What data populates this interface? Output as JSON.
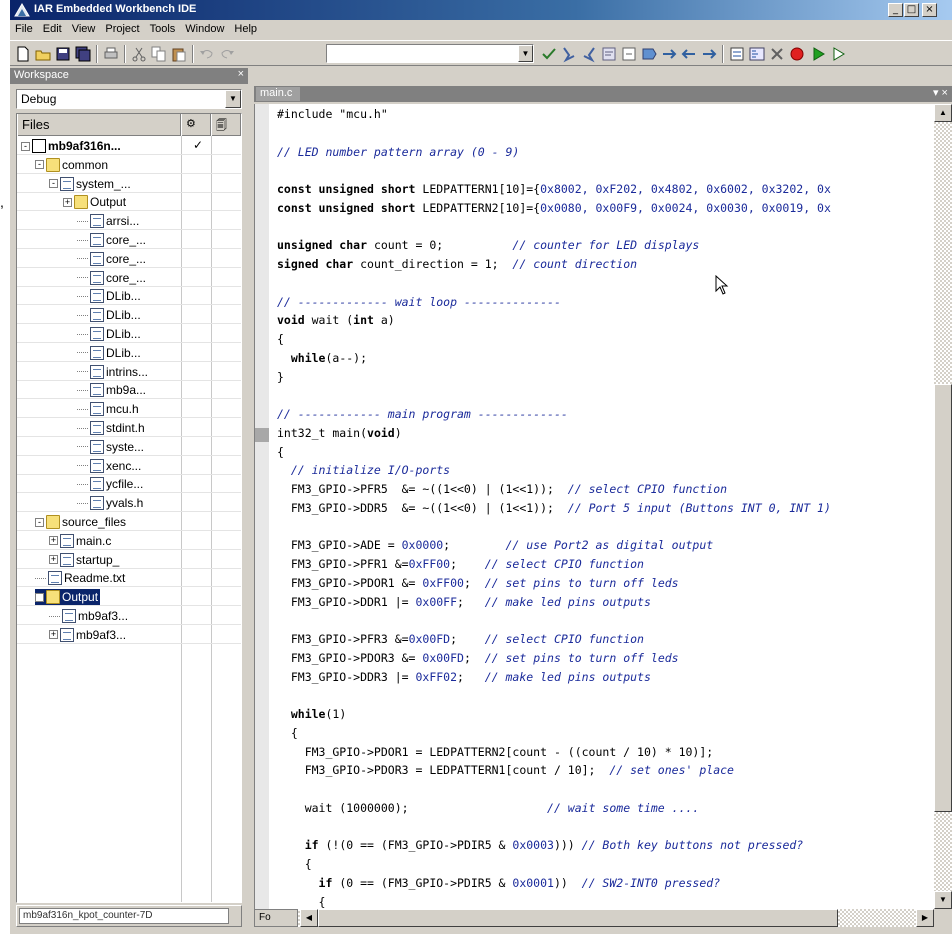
{
  "window": {
    "title": "IAR Embedded Workbench IDE"
  },
  "title_buttons": {
    "minimize": "_",
    "maximize": "□",
    "close": "×"
  },
  "menu": [
    "File",
    "Edit",
    "View",
    "Project",
    "Tools",
    "Window",
    "Help"
  ],
  "workspace": {
    "header_label": "Workspace",
    "close_glyph": "×",
    "configuration": "Debug",
    "columns": {
      "files": "Files",
      "col2": "⚙",
      "col3": "🗐"
    },
    "tree": [
      {
        "label": "mb9af316n...",
        "check": "✓"
      },
      {
        "label": "common"
      },
      {
        "label": "system_..."
      },
      {
        "label": "Output"
      },
      {
        "label": "arrsi..."
      },
      {
        "label": "core_..."
      },
      {
        "label": "core_..."
      },
      {
        "label": "core_..."
      },
      {
        "label": "DLib..."
      },
      {
        "label": "DLib..."
      },
      {
        "label": "DLib..."
      },
      {
        "label": "DLib..."
      },
      {
        "label": "intrins..."
      },
      {
        "label": "mb9a..."
      },
      {
        "label": "mcu.h"
      },
      {
        "label": "stdint.h"
      },
      {
        "label": "syste..."
      },
      {
        "label": "xenc..."
      },
      {
        "label": "ycfile..."
      },
      {
        "label": "yvals.h"
      },
      {
        "label": "source_files"
      },
      {
        "label": "main.c"
      },
      {
        "label": "startup_"
      },
      {
        "label": "Readme.txt"
      },
      {
        "label": "Output"
      },
      {
        "label": "mb9af3..."
      },
      {
        "label": "mb9af3..."
      }
    ],
    "footer_tab": "mb9af316n_kpot_counter-7D"
  },
  "editor": {
    "tab_label": "main.c",
    "tab_controls": "▾ ×",
    "bottom_tab": "Fo",
    "lines": [
      {
        "parts": [
          {
            "t": "#include \"mcu.h\"",
            "c": "str"
          }
        ]
      },
      {
        "parts": []
      },
      {
        "parts": [
          {
            "t": "// LED number pattern array (0 - 9)",
            "c": "cm"
          }
        ]
      },
      {
        "parts": []
      },
      {
        "parts": [
          {
            "t": "const unsigned short ",
            "c": "kw"
          },
          {
            "t": "LEDPATTERN1[10]={",
            "c": "str"
          },
          {
            "t": "0x8002, 0xF202, 0x4802, 0x6002, 0x3202, 0x",
            "c": "num"
          }
        ]
      },
      {
        "parts": [
          {
            "t": "const unsigned short ",
            "c": "kw"
          },
          {
            "t": "LEDPATTERN2[10]={",
            "c": "str"
          },
          {
            "t": "0x0080, 0x00F9, 0x0024, 0x0030, 0x0019, 0x",
            "c": "num"
          }
        ]
      },
      {
        "parts": []
      },
      {
        "parts": [
          {
            "t": "unsigned char ",
            "c": "kw"
          },
          {
            "t": "count = 0;          ",
            "c": "str"
          },
          {
            "t": "// counter for LED displays",
            "c": "cm"
          }
        ]
      },
      {
        "parts": [
          {
            "t": "signed char ",
            "c": "kw"
          },
          {
            "t": "count_direction = 1;  ",
            "c": "str"
          },
          {
            "t": "// count direction",
            "c": "cm"
          }
        ]
      },
      {
        "parts": []
      },
      {
        "parts": [
          {
            "t": "// ------------- wait loop --------------",
            "c": "cm"
          }
        ]
      },
      {
        "parts": [
          {
            "t": "void ",
            "c": "kw"
          },
          {
            "t": "wait (",
            "c": "str"
          },
          {
            "t": "int ",
            "c": "kw"
          },
          {
            "t": "a)",
            "c": "str"
          }
        ]
      },
      {
        "parts": [
          {
            "t": "{",
            "c": "str"
          }
        ]
      },
      {
        "parts": [
          {
            "t": "  while",
            "c": "kw"
          },
          {
            "t": "(a--);",
            "c": "str"
          }
        ]
      },
      {
        "parts": [
          {
            "t": "}",
            "c": "str"
          }
        ]
      },
      {
        "parts": []
      },
      {
        "parts": [
          {
            "t": "// ------------ main program -------------",
            "c": "cm"
          }
        ]
      },
      {
        "parts": [
          {
            "t": "int32_t main(",
            "c": "str"
          },
          {
            "t": "void",
            "c": "kw"
          },
          {
            "t": ")",
            "c": "str"
          }
        ]
      },
      {
        "parts": [
          {
            "t": "{",
            "c": "str"
          }
        ]
      },
      {
        "parts": [
          {
            "t": "  // initialize I/O-ports",
            "c": "cm"
          }
        ]
      },
      {
        "parts": [
          {
            "t": "  FM3_GPIO->PFR5  &= ~((1<<0) | (1<<1));  ",
            "c": "str"
          },
          {
            "t": "// select CPIO function",
            "c": "cm"
          }
        ]
      },
      {
        "parts": [
          {
            "t": "  FM3_GPIO->DDR5  &= ~((1<<0) | (1<<1));  ",
            "c": "str"
          },
          {
            "t": "// Port 5 input (Buttons INT 0, INT 1)",
            "c": "cm"
          }
        ]
      },
      {
        "parts": []
      },
      {
        "parts": [
          {
            "t": "  FM3_GPIO->ADE = ",
            "c": "str"
          },
          {
            "t": "0x0000",
            "c": "num"
          },
          {
            "t": ";        ",
            "c": "str"
          },
          {
            "t": "// use Port2 as digital output",
            "c": "cm"
          }
        ]
      },
      {
        "parts": [
          {
            "t": "  FM3_GPIO->PFR1 &=",
            "c": "str"
          },
          {
            "t": "0xFF00",
            "c": "num"
          },
          {
            "t": ";    ",
            "c": "str"
          },
          {
            "t": "// select CPIO function",
            "c": "cm"
          }
        ]
      },
      {
        "parts": [
          {
            "t": "  FM3_GPIO->PDOR1 &= ",
            "c": "str"
          },
          {
            "t": "0xFF00",
            "c": "num"
          },
          {
            "t": ";  ",
            "c": "str"
          },
          {
            "t": "// set pins to turn off leds",
            "c": "cm"
          }
        ]
      },
      {
        "parts": [
          {
            "t": "  FM3_GPIO->DDR1 |= ",
            "c": "str"
          },
          {
            "t": "0x00FF",
            "c": "num"
          },
          {
            "t": ";   ",
            "c": "str"
          },
          {
            "t": "// make led pins outputs",
            "c": "cm"
          }
        ]
      },
      {
        "parts": []
      },
      {
        "parts": [
          {
            "t": "  FM3_GPIO->PFR3 &=",
            "c": "str"
          },
          {
            "t": "0x00FD",
            "c": "num"
          },
          {
            "t": ";    ",
            "c": "str"
          },
          {
            "t": "// select CPIO function",
            "c": "cm"
          }
        ]
      },
      {
        "parts": [
          {
            "t": "  FM3_GPIO->PDOR3 &= ",
            "c": "str"
          },
          {
            "t": "0x00FD",
            "c": "num"
          },
          {
            "t": ";  ",
            "c": "str"
          },
          {
            "t": "// set pins to turn off leds",
            "c": "cm"
          }
        ]
      },
      {
        "parts": [
          {
            "t": "  FM3_GPIO->DDR3 |= ",
            "c": "str"
          },
          {
            "t": "0xFF02",
            "c": "num"
          },
          {
            "t": ";   ",
            "c": "str"
          },
          {
            "t": "// make led pins outputs",
            "c": "cm"
          }
        ]
      },
      {
        "parts": []
      },
      {
        "parts": [
          {
            "t": "  while",
            "c": "kw"
          },
          {
            "t": "(1)",
            "c": "str"
          }
        ]
      },
      {
        "parts": [
          {
            "t": "  {",
            "c": "str"
          }
        ]
      },
      {
        "parts": [
          {
            "t": "    FM3_GPIO->PDOR1 = LEDPATTERN2[count - ((count / 10) * 10)];",
            "c": "str"
          }
        ]
      },
      {
        "parts": [
          {
            "t": "    FM3_GPIO->PDOR3 = LEDPATTERN1[count / 10];  ",
            "c": "str"
          },
          {
            "t": "// set ones' place",
            "c": "cm"
          }
        ]
      },
      {
        "parts": []
      },
      {
        "parts": [
          {
            "t": "    wait (1000000);                    ",
            "c": "str"
          },
          {
            "t": "// wait some time ....",
            "c": "cm"
          }
        ]
      },
      {
        "parts": []
      },
      {
        "parts": [
          {
            "t": "    if ",
            "c": "kw"
          },
          {
            "t": "(!(0 == (FM3_GPIO->PDIR5 & ",
            "c": "str"
          },
          {
            "t": "0x0003",
            "c": "num"
          },
          {
            "t": "))) ",
            "c": "str"
          },
          {
            "t": "// Both key buttons not pressed?",
            "c": "cm"
          }
        ]
      },
      {
        "parts": [
          {
            "t": "    {",
            "c": "str"
          }
        ]
      },
      {
        "parts": [
          {
            "t": "      if ",
            "c": "kw"
          },
          {
            "t": "(0 == (FM3_GPIO->PDIR5 & ",
            "c": "str"
          },
          {
            "t": "0x0001",
            "c": "num"
          },
          {
            "t": "))  ",
            "c": "str"
          },
          {
            "t": "// SW2-INT0 pressed?",
            "c": "cm"
          }
        ]
      },
      {
        "parts": [
          {
            "t": "      {",
            "c": "str"
          }
        ]
      }
    ]
  },
  "colors": {
    "title_start": "#0a246a",
    "title_end": "#a6caf0",
    "comment": "#1a2a9a",
    "selection": "#0a246a",
    "chrome": "#d4d0c8"
  },
  "side_text": ","
}
